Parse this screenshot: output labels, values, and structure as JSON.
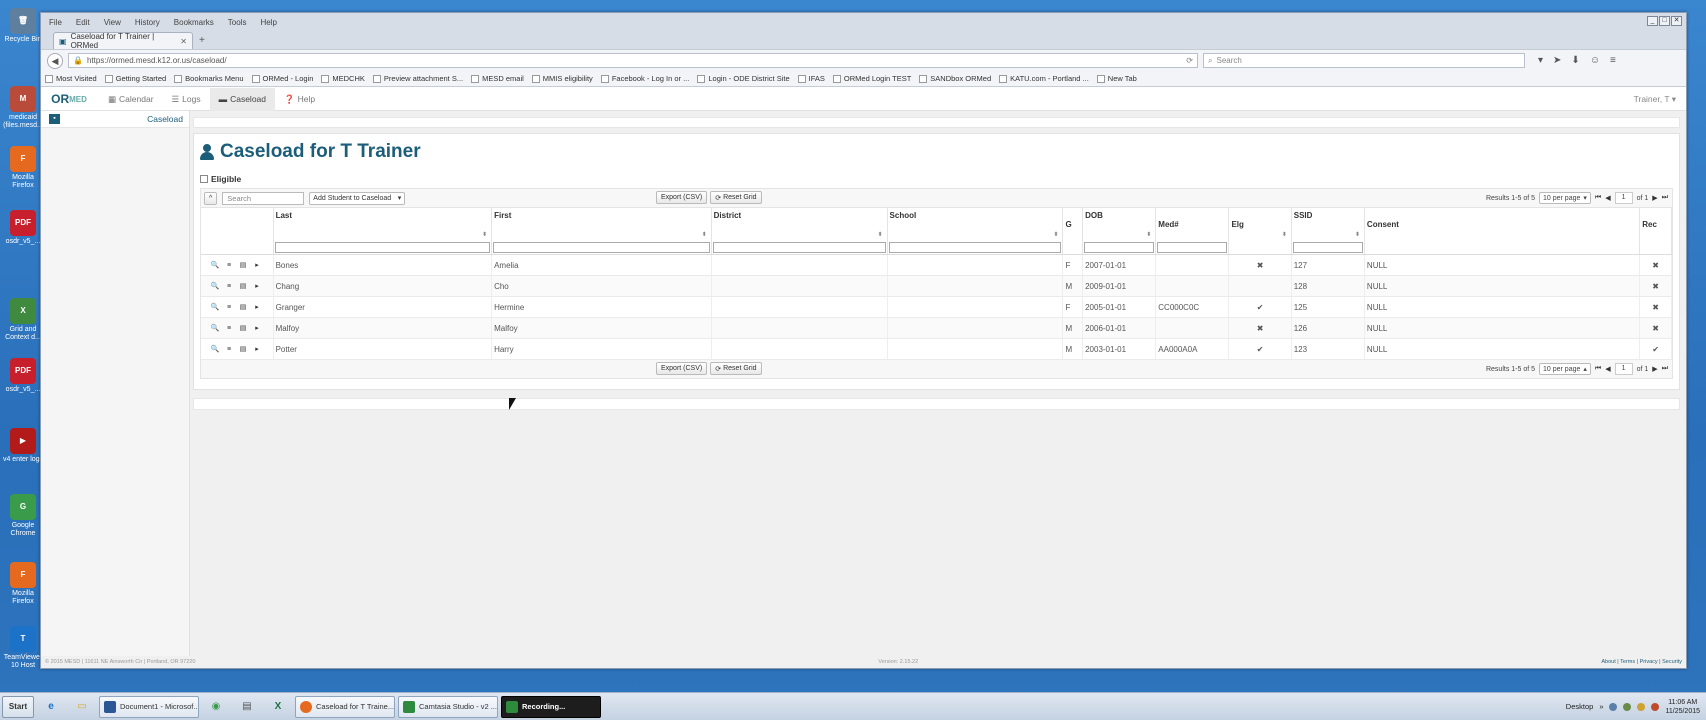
{
  "desktop": {
    "icons": [
      {
        "label": "Recycle Bin",
        "glyph": "🗑",
        "color": "#5e7f9e"
      },
      {
        "label": "medicaid (files.mesd...",
        "glyph": "M",
        "color": "#b94b3b"
      },
      {
        "label": "Mozilla Firefox",
        "glyph": "F",
        "color": "#e56a1f"
      },
      {
        "label": "osdr_v5_...",
        "glyph": "PDF",
        "color": "#c7202c"
      },
      {
        "label": "Grid and Context d...",
        "glyph": "X",
        "color": "#3f8a3f"
      },
      {
        "label": "osdr_v5_...",
        "glyph": "PDF",
        "color": "#c7202c"
      },
      {
        "label": "v4 enter logs",
        "glyph": "▶",
        "color": "#b31b1b"
      },
      {
        "label": "Google Chrome",
        "glyph": "G",
        "color": "#3a9b4a"
      },
      {
        "label": "Mozilla Firefox",
        "glyph": "F",
        "color": "#e56a1f"
      },
      {
        "label": "TeamViewer 10 Host",
        "glyph": "T",
        "color": "#1b72c7"
      }
    ]
  },
  "browser": {
    "menu": [
      "File",
      "Edit",
      "View",
      "History",
      "Bookmarks",
      "Tools",
      "Help"
    ],
    "tab_title": "Caseload for T Trainer | ORMed",
    "new_tab": "+",
    "url": "https://ormed.mesd.k12.or.us/caseload/",
    "search_placeholder": "Search",
    "bookmarks": [
      "Most Visited",
      "Getting Started",
      "Bookmarks Menu",
      "ORMed - Login",
      "MEDCHK",
      "Preview attachment S...",
      "MESD email",
      "MMIS eligibility",
      "Facebook - Log In or ...",
      "Login - ODE District Site",
      "IFAS",
      "ORMed Login TEST",
      "SANDbox ORMed",
      "KATU.com - Portland ...",
      "New Tab"
    ]
  },
  "app": {
    "logo_main": "OR",
    "logo_sub": "MED",
    "nav": {
      "calendar": "Calendar",
      "logs": "Logs",
      "caseload": "Caseload",
      "help": "Help"
    },
    "user": "Trainer, T ▾",
    "sidebar_item": "Caseload",
    "page_title": "Caseload for T Trainer",
    "eligible_label": "Eligible",
    "toolbar": {
      "collapse": "^",
      "search_placeholder": "Search",
      "add_student": "Add Student to Caseload",
      "export": "Export (CSV)",
      "reset": "Reset Grid",
      "results": "Results 1-5 of 5",
      "per_page": "10 per page",
      "page": "1",
      "of": "of 1"
    },
    "columns": {
      "last": "Last",
      "first": "First",
      "district": "District",
      "school": "School",
      "g": "G",
      "dob": "DOB",
      "medid": "Med#",
      "elg": "Elg",
      "ssid": "SSID",
      "consent": "Consent",
      "rec": "Rec"
    },
    "rows": [
      {
        "last": "Bones",
        "first": "Amelia",
        "district": "",
        "school": "",
        "g": "F",
        "dob": "2007-01-01",
        "medid": "",
        "elg": "✖",
        "ssid": "127",
        "consent": "NULL",
        "rec": "✖"
      },
      {
        "last": "Chang",
        "first": "Cho",
        "district": "",
        "school": "",
        "g": "M",
        "dob": "2009-01-01",
        "medid": "",
        "elg": "",
        "ssid": "128",
        "consent": "NULL",
        "rec": "✖"
      },
      {
        "last": "Granger",
        "first": "Hermine",
        "district": "",
        "school": "",
        "g": "F",
        "dob": "2005-01-01",
        "medid": "CC000C0C",
        "elg": "✔",
        "ssid": "125",
        "consent": "NULL",
        "rec": "✖"
      },
      {
        "last": "Malfoy",
        "first": "Malfoy",
        "district": "",
        "school": "",
        "g": "M",
        "dob": "2006-01-01",
        "medid": "",
        "elg": "✖",
        "ssid": "126",
        "consent": "NULL",
        "rec": "✖"
      },
      {
        "last": "Potter",
        "first": "Harry",
        "district": "",
        "school": "",
        "g": "M",
        "dob": "2003-01-01",
        "medid": "AA000A0A",
        "elg": "✔",
        "ssid": "123",
        "consent": "NULL",
        "rec": "✔"
      }
    ],
    "footer_left": "© 2015 MESD | 11611 NE Ainsworth Cir | Portland, OR 97220",
    "footer_mid": "Version: 2.15.22",
    "footer_right": "About | Terms | Privacy | Security"
  },
  "taskbar": {
    "start": "Start",
    "tasks": [
      {
        "label": "Document1 - Microsof...",
        "color": "#2b5797",
        "glyph": "W"
      },
      {
        "label": "Caseload for T Traine...",
        "color": "#e56a1f",
        "glyph": ""
      },
      {
        "label": "Camtasia Studio - v2 ...",
        "color": "#2e8b3e",
        "glyph": "C"
      },
      {
        "label": "Recording...",
        "color": "#2e8b3e",
        "glyph": "C"
      }
    ],
    "tray_desktop": "Desktop",
    "time": "11:06 AM",
    "date": "11/25/2015"
  }
}
